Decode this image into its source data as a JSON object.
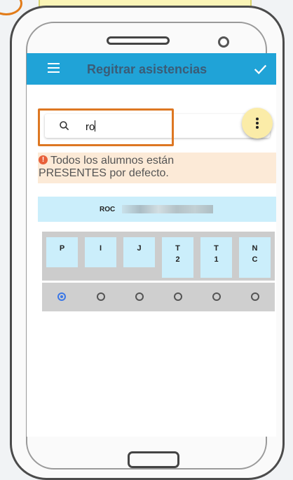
{
  "app": {
    "title": "Regitrar asistencias"
  },
  "toolbar": {
    "menu_icon": "menu-icon",
    "confirm_icon": "check-icon"
  },
  "search": {
    "value": "ro",
    "icon": "search-icon"
  },
  "fab": {
    "icon": "more-vert-icon"
  },
  "alert": {
    "line1": "Todos los alumnos están",
    "line2": "PRESENTES por defecto."
  },
  "student": {
    "name_visible": "ROC"
  },
  "attendance_codes": [
    {
      "line1": "P",
      "line2": ""
    },
    {
      "line1": "I",
      "line2": ""
    },
    {
      "line1": "J",
      "line2": ""
    },
    {
      "line1": "T",
      "line2": "2"
    },
    {
      "line1": "T",
      "line2": "1"
    },
    {
      "line1": "N",
      "line2": "C"
    }
  ],
  "selection": {
    "selected_index": 0
  },
  "colors": {
    "appbar": "#20a3d7",
    "title": "#3b5c77",
    "highlight": "#dd7722",
    "alert_bg": "#fcead7",
    "cell_bg": "#cbeefb",
    "fab": "#fbeca8"
  }
}
